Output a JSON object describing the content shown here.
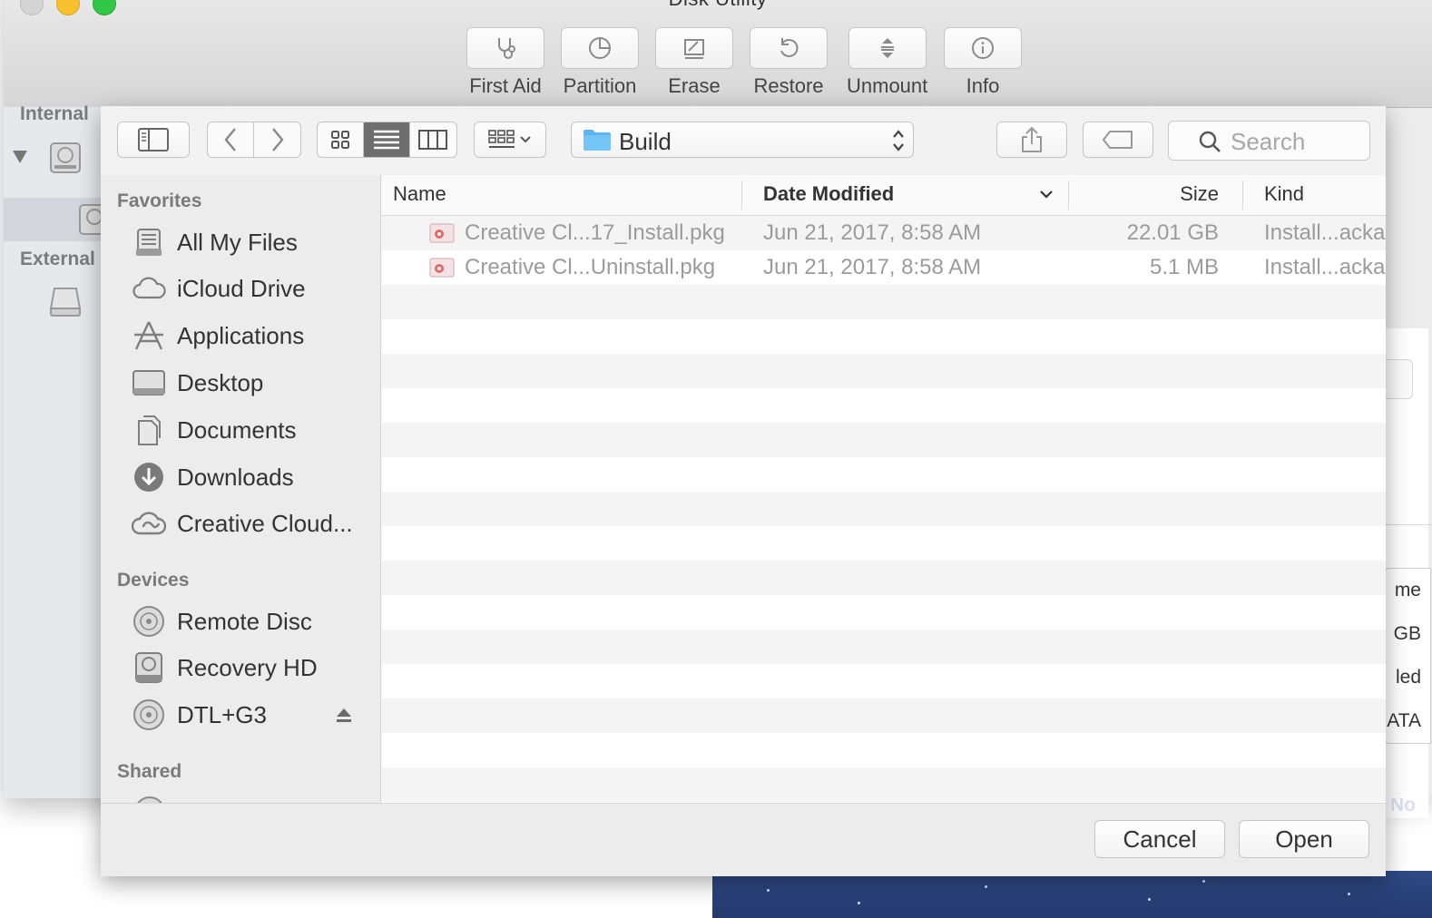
{
  "disk_utility": {
    "title": "Disk Utility",
    "toolbar": [
      {
        "label": "First Aid",
        "icon": "stethoscope-icon"
      },
      {
        "label": "Partition",
        "icon": "pie-icon"
      },
      {
        "label": "Erase",
        "icon": "eraser-icon"
      },
      {
        "label": "Restore",
        "icon": "restore-icon"
      },
      {
        "label": "Unmount",
        "icon": "unmount-icon"
      },
      {
        "label": "Info",
        "icon": "info-icon"
      }
    ],
    "sidebar": {
      "internal_heading": "Internal",
      "external_heading": "External"
    },
    "info_fragments": [
      "me",
      "GB",
      "led",
      "ATA"
    ],
    "desktop_fragment": "No"
  },
  "open_panel": {
    "path_popup": {
      "folder": "Build"
    },
    "search": {
      "placeholder": "Search"
    },
    "sidebar": {
      "favorites_heading": "Favorites",
      "favorites": [
        {
          "label": "All My Files",
          "icon": "all-files-icon"
        },
        {
          "label": "iCloud Drive",
          "icon": "cloud-icon"
        },
        {
          "label": "Applications",
          "icon": "applications-icon"
        },
        {
          "label": "Desktop",
          "icon": "desktop-icon"
        },
        {
          "label": "Documents",
          "icon": "documents-icon"
        },
        {
          "label": "Downloads",
          "icon": "downloads-icon"
        },
        {
          "label": "Creative Cloud...",
          "icon": "creative-cloud-icon"
        }
      ],
      "devices_heading": "Devices",
      "devices": [
        {
          "label": "Remote Disc",
          "icon": "disc-icon"
        },
        {
          "label": "Recovery HD",
          "icon": "hard-drive-icon"
        },
        {
          "label": "DTL+G3",
          "icon": "disc-icon"
        }
      ],
      "shared_heading": "Shared"
    },
    "columns": {
      "name": "Name",
      "date_modified": "Date Modified",
      "size": "Size",
      "kind": "Kind"
    },
    "files": [
      {
        "name": "Creative Cl...17_Install.pkg",
        "date": "Jun 21, 2017, 8:58 AM",
        "size": "22.01 GB",
        "kind": "Install...acka"
      },
      {
        "name": "Creative Cl...Uninstall.pkg",
        "date": "Jun 21, 2017, 8:58 AM",
        "size": "5.1 MB",
        "kind": "Install...acka"
      }
    ],
    "buttons": {
      "cancel": "Cancel",
      "open": "Open"
    }
  }
}
